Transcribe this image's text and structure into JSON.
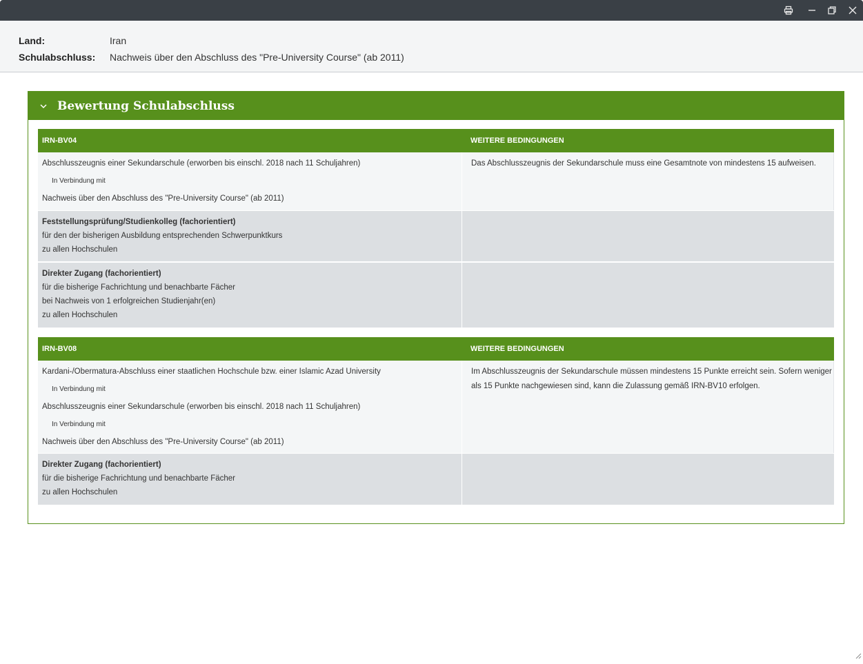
{
  "header": {
    "land_label": "Land:",
    "land_value": "Iran",
    "abschluss_label": "Schulabschluss:",
    "abschluss_value": "Nachweis über den Abschluss des \"Pre-University Course\" (ab 2011)"
  },
  "panel": {
    "title": "Bewertung Schulabschluss"
  },
  "tables": [
    {
      "code": "IRN-BV04",
      "cond_header": "WEITERE BEDINGUNGEN",
      "req_lines": [
        "Abschlusszeugnis einer Sekundarschule (erworben bis einschl. 2018 nach 11 Schuljahren)",
        "In Verbindung mit",
        "Nachweis über den Abschluss des \"Pre-University Course\" (ab 2011)"
      ],
      "condition": "Das Abschlusszeugnis der Sekundarschule muss eine Gesamtnote von mindestens 15 aufweisen.",
      "accesses": [
        {
          "title": "Feststellungsprüfung/Studienkolleg (fachorientiert)",
          "lines": [
            "für den der bisherigen Ausbildung entsprechenden Schwerpunktkurs",
            "zu allen Hochschulen"
          ]
        },
        {
          "title": "Direkter Zugang (fachorientiert)",
          "lines": [
            "für die bisherige Fachrichtung und benachbarte Fächer",
            "bei Nachweis von 1 erfolgreichen Studienjahr(en)",
            "zu allen Hochschulen"
          ]
        }
      ]
    },
    {
      "code": "IRN-BV08",
      "cond_header": "WEITERE BEDINGUNGEN",
      "req_lines": [
        "Kardani-/Obermatura-Abschluss einer staatlichen Hochschule bzw. einer Islamic Azad University",
        "In Verbindung mit",
        "Abschlusszeugnis einer Sekundarschule (erworben bis einschl. 2018 nach 11 Schuljahren)",
        "In Verbindung mit",
        "Nachweis über den Abschluss des \"Pre-University Course\" (ab 2011)"
      ],
      "condition_lines": [
        "Im Abschlusszeugnis der Sekundarschule müssen mindestens 15 Punkte erreicht sein. Sofern weniger",
        "als 15 Punkte nachgewiesen sind, kann die Zulassung gemäß IRN-BV10 erfolgen."
      ],
      "accesses": [
        {
          "title": "Direkter Zugang (fachorientiert)",
          "lines": [
            "für die bisherige Fachrichtung und benachbarte Fächer",
            "zu allen Hochschulen"
          ]
        }
      ]
    }
  ]
}
